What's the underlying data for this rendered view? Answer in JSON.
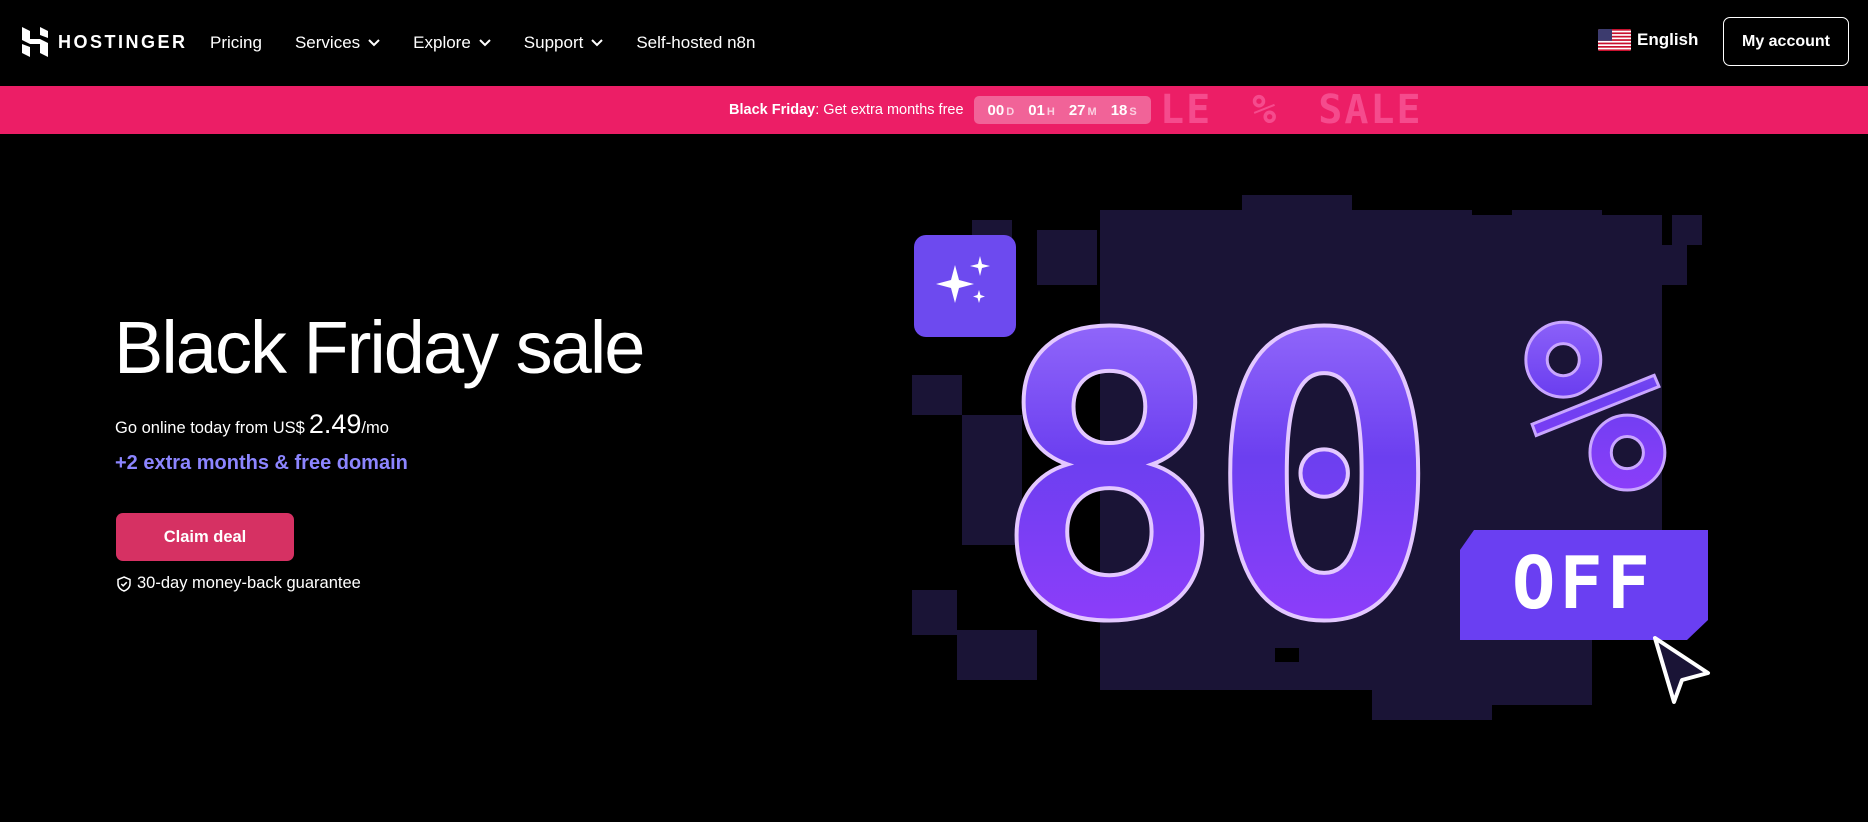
{
  "header": {
    "brand": "HOSTINGER",
    "nav": [
      {
        "label": "Pricing",
        "dropdown": false
      },
      {
        "label": "Services",
        "dropdown": true
      },
      {
        "label": "Explore",
        "dropdown": true
      },
      {
        "label": "Support",
        "dropdown": true
      },
      {
        "label": "Self-hosted n8n",
        "dropdown": false
      }
    ],
    "language": "English",
    "account_button": "My account"
  },
  "banner": {
    "bold": "Black Friday",
    "text": ": Get extra months free",
    "countdown": [
      {
        "value": "00",
        "unit": "D"
      },
      {
        "value": "01",
        "unit": "H"
      },
      {
        "value": "27",
        "unit": "M"
      },
      {
        "value": "18",
        "unit": "S"
      }
    ],
    "decor": [
      "LE",
      "%",
      "SALE"
    ],
    "color": "#ec1e66"
  },
  "hero": {
    "title": "Black Friday sale",
    "subtitle_prefix": "Go online today from US$",
    "price": "2.49",
    "price_suffix": "/mo",
    "extra": "+2 extra months & free domain",
    "cta": "Claim deal",
    "guarantee": "30-day money-back guarantee"
  },
  "promo_graphic": {
    "big_text": "80",
    "percent": "%",
    "badge": "OFF",
    "icon": "sparkles-icon",
    "accent": "#7b4dff"
  }
}
